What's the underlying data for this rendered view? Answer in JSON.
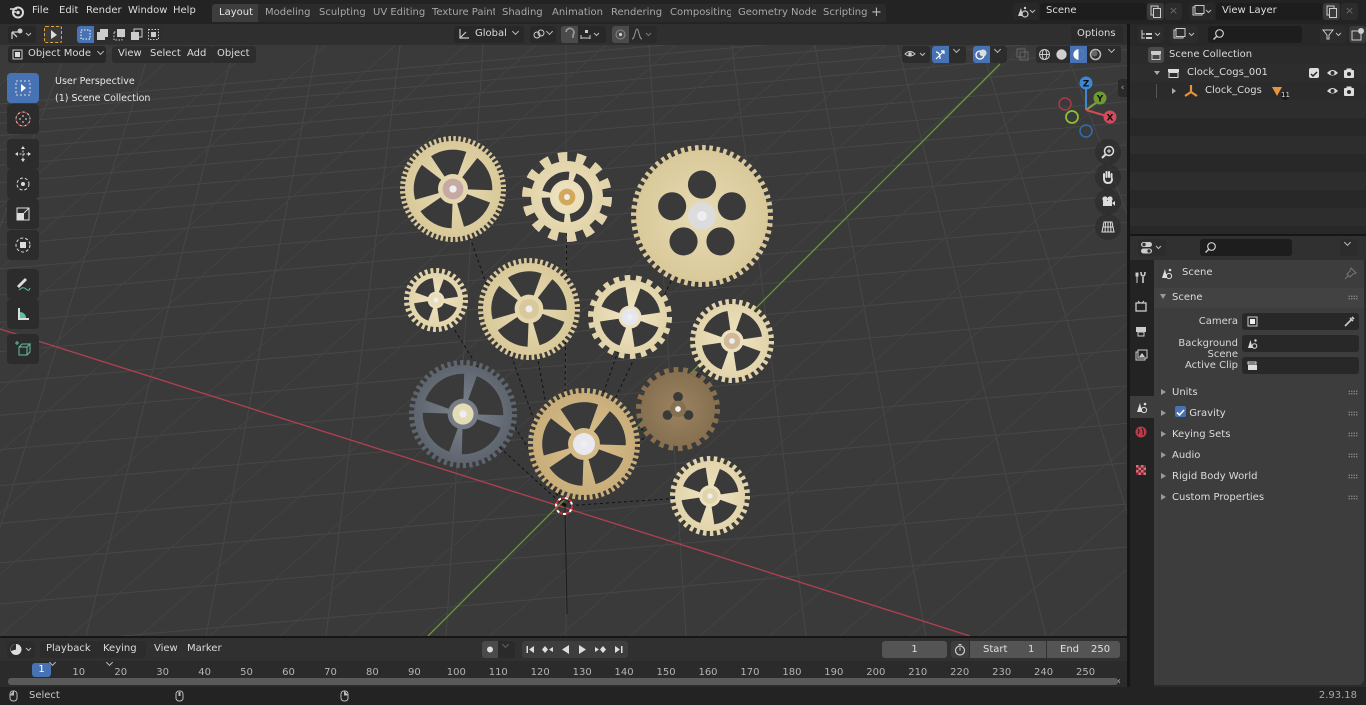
{
  "app": {
    "menu": [
      "File",
      "Edit",
      "Render",
      "Window",
      "Help"
    ],
    "workspaces": [
      "Layout",
      "Modeling",
      "Sculpting",
      "UV Editing",
      "Texture Paint",
      "Shading",
      "Animation",
      "Rendering",
      "Compositing",
      "Geometry Nodes",
      "Scripting"
    ],
    "active_workspace": "Layout",
    "add_workspace": "+",
    "scene_name": "Scene",
    "view_layer_name": "View Layer"
  },
  "viewport": {
    "mode": "Object Mode",
    "menus": [
      "View",
      "Select",
      "Add",
      "Object"
    ],
    "transform_orientation": "Global",
    "options_label": "Options",
    "overlay_text": [
      "User Perspective",
      "(1) Scene Collection"
    ],
    "tools": [
      "select-box-tool",
      "cursor-tool",
      "move-tool",
      "rotate-tool",
      "scale-tool",
      "transform-tool",
      "annotate-tool",
      "measure-tool",
      "add-cube-tool"
    ],
    "gizmo_axes": {
      "x": "X",
      "y": "Y",
      "z": "Z"
    },
    "colors": {
      "x_axis": "#d44a5a",
      "y_axis": "#7aa43a",
      "z_axis": "#3d88d6",
      "accent": "#4772b3"
    }
  },
  "outliner": {
    "root": "Scene Collection",
    "items": [
      {
        "name": "Clock_Cogs_001",
        "type": "collection"
      },
      {
        "name": "Clock_Cogs",
        "type": "empty",
        "children_count": "11"
      }
    ]
  },
  "properties": {
    "context": "Scene",
    "section": "Scene",
    "fields": [
      {
        "label": "Camera",
        "value": ""
      },
      {
        "label": "Background Scene",
        "value": ""
      },
      {
        "label": "Active Clip",
        "value": ""
      }
    ],
    "panels": [
      {
        "label": "Units"
      },
      {
        "label": "Gravity",
        "checked": true
      },
      {
        "label": "Keying Sets"
      },
      {
        "label": "Audio"
      },
      {
        "label": "Rigid Body World"
      },
      {
        "label": "Custom Properties"
      }
    ]
  },
  "timeline": {
    "menus": [
      "Playback",
      "Keying",
      "View",
      "Marker"
    ],
    "current_frame": "1",
    "start_label": "Start",
    "start": "1",
    "end_label": "End",
    "end": "250",
    "ticks": [
      "10",
      "20",
      "30",
      "40",
      "50",
      "60",
      "70",
      "80",
      "90",
      "100",
      "110",
      "120",
      "130",
      "140",
      "150",
      "160",
      "170",
      "180",
      "190",
      "200",
      "210",
      "220",
      "230",
      "240",
      "250"
    ],
    "playhead_label": "1"
  },
  "status": {
    "left_hint": "Select",
    "version": "2.93.18"
  }
}
